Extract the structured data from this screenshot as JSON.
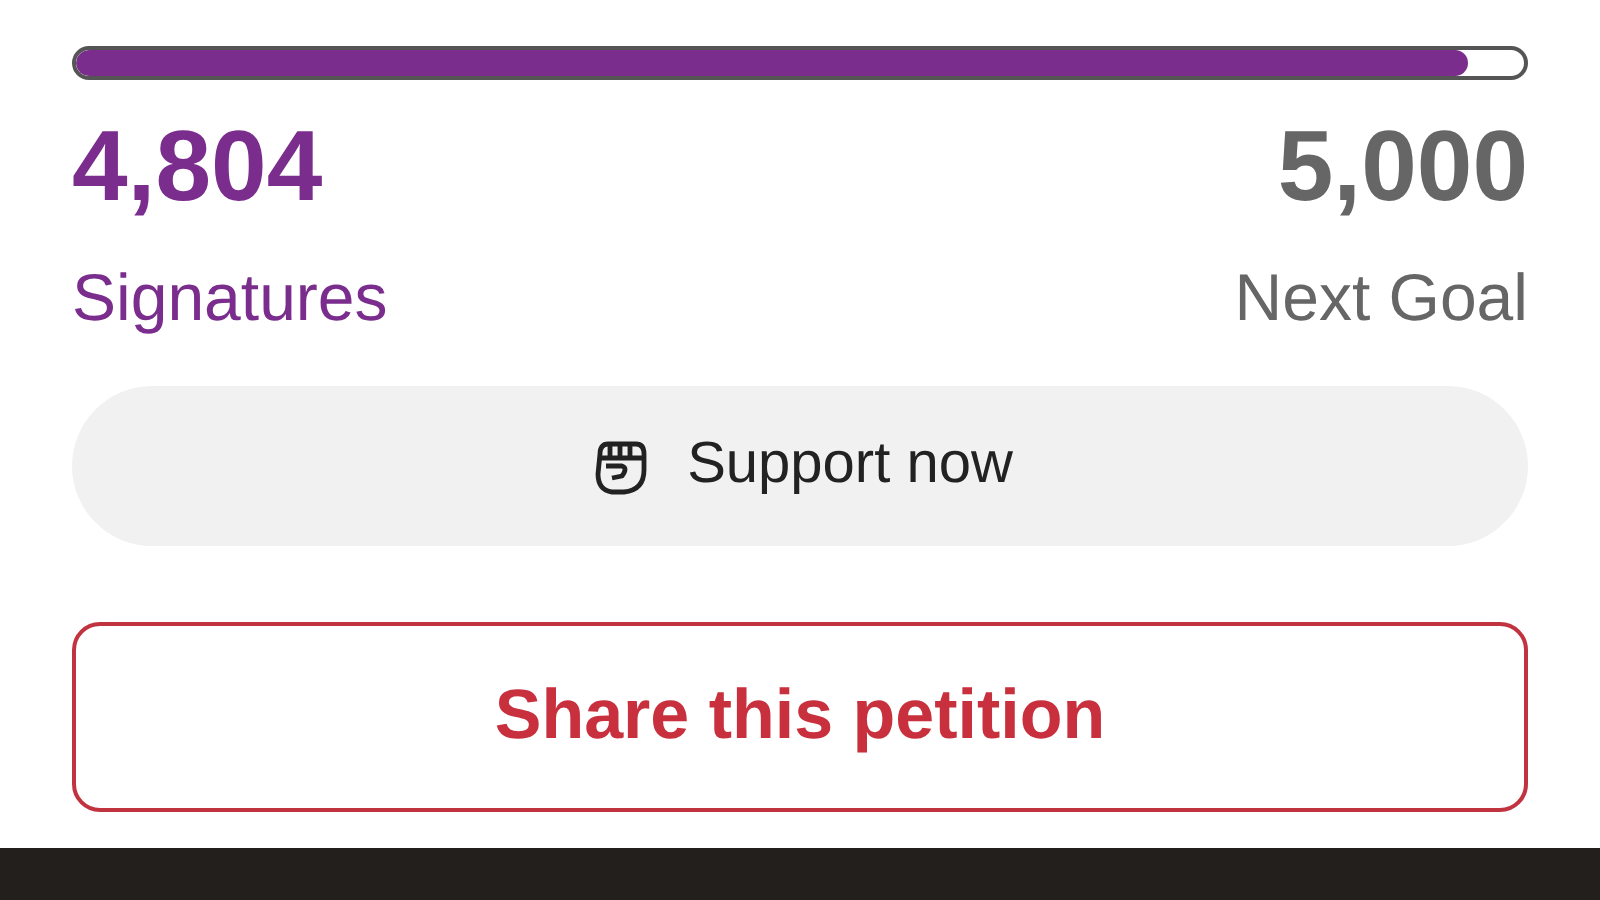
{
  "progress": {
    "level": 0.9608
  },
  "count": {
    "value": "4,804",
    "label": "Signatures"
  },
  "goal": {
    "value": "5,000",
    "label": "Next Goal"
  },
  "support_button": {
    "label": "Support now"
  },
  "share_button": {
    "label": "Share this petition"
  }
}
